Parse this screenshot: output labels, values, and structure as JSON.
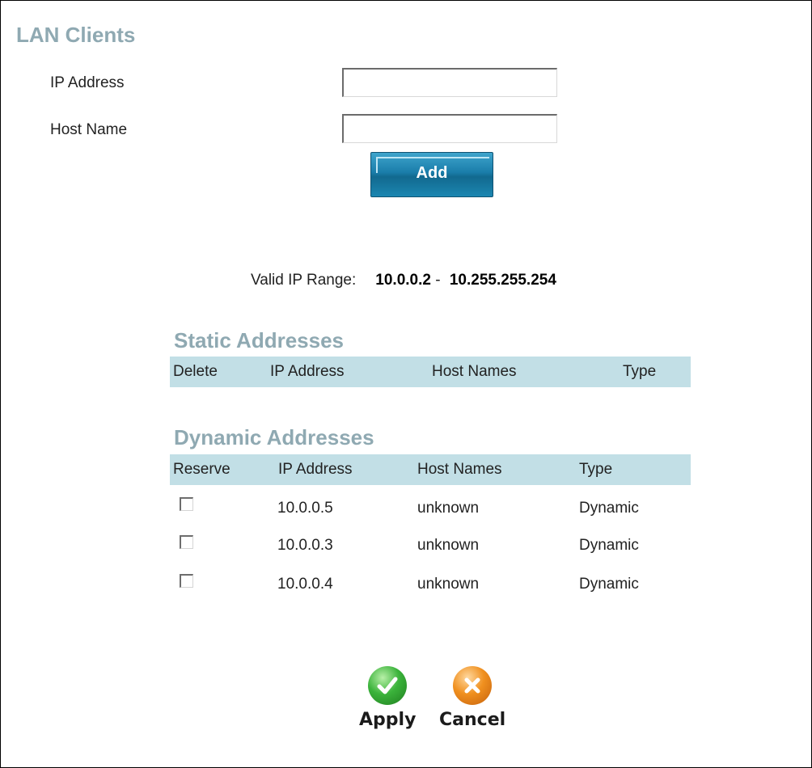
{
  "page": {
    "title": "LAN Clients"
  },
  "form": {
    "ip_label": "IP Address",
    "ip_value": "",
    "host_label": "Host Name",
    "host_value": "",
    "add_label": "Add"
  },
  "range": {
    "label": "Valid IP Range:",
    "start": "10.0.0.2",
    "separator": " - ",
    "end": "10.255.255.254"
  },
  "static": {
    "title": "Static Addresses",
    "columns": [
      "Delete",
      "IP Address",
      "Host Names",
      "Type"
    ]
  },
  "dynamic": {
    "title": "Dynamic Addresses",
    "columns": [
      "Reserve",
      "IP Address",
      "Host Names",
      "Type"
    ],
    "rows": [
      {
        "ip": "10.0.0.5",
        "host": "unknown",
        "type": "Dynamic",
        "reserved": false
      },
      {
        "ip": "10.0.0.3",
        "host": "unknown",
        "type": "Dynamic",
        "reserved": false
      },
      {
        "ip": "10.0.0.4",
        "host": "unknown",
        "type": "Dynamic",
        "reserved": false
      }
    ]
  },
  "actions": {
    "apply_label": "Apply",
    "cancel_label": "Cancel",
    "apply_icon": "check-icon",
    "cancel_icon": "x-icon",
    "apply_color": "#2e9f2e",
    "cancel_color": "#e0801c"
  }
}
